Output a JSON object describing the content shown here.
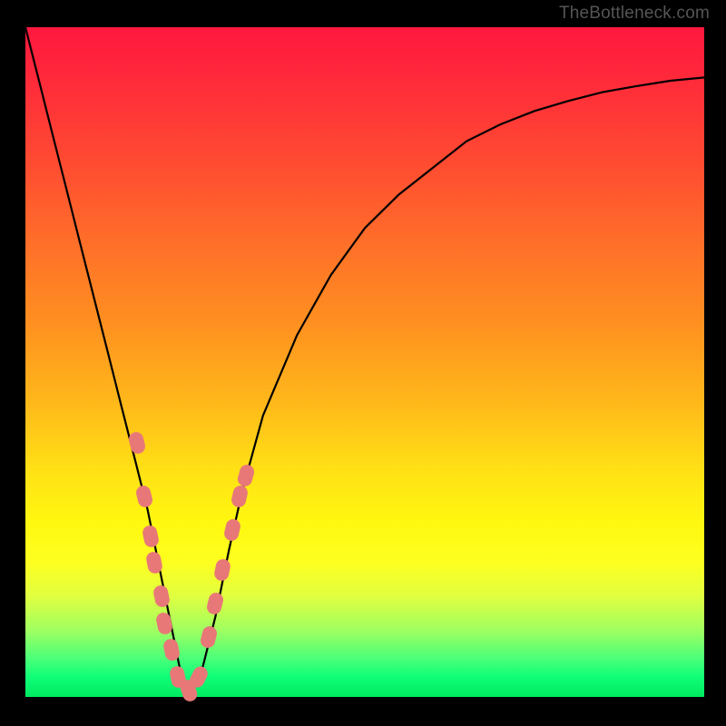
{
  "watermark": "TheBottleneck.com",
  "chart_data": {
    "type": "line",
    "title": "",
    "xlabel": "",
    "ylabel": "",
    "xlim": [
      0,
      100
    ],
    "ylim": [
      0,
      100
    ],
    "series": [
      {
        "name": "curve",
        "x": [
          0,
          2,
          4,
          6,
          8,
          10,
          12,
          14,
          16,
          18,
          20,
          22,
          23,
          24,
          26,
          28,
          30,
          32,
          35,
          40,
          45,
          50,
          55,
          60,
          65,
          70,
          75,
          80,
          85,
          90,
          95,
          100
        ],
        "y": [
          100,
          92,
          84,
          76,
          68,
          60,
          52,
          44,
          36,
          28,
          18,
          8,
          3,
          0,
          4,
          12,
          22,
          31,
          42,
          54,
          63,
          70,
          75,
          79,
          83,
          85.5,
          87.5,
          89,
          90.3,
          91.2,
          92,
          92.5
        ]
      }
    ],
    "markers": [
      {
        "x": 16.5,
        "y": 38
      },
      {
        "x": 17.5,
        "y": 30
      },
      {
        "x": 18.5,
        "y": 24
      },
      {
        "x": 19.0,
        "y": 20
      },
      {
        "x": 20.0,
        "y": 15
      },
      {
        "x": 20.5,
        "y": 11
      },
      {
        "x": 21.5,
        "y": 7
      },
      {
        "x": 22.5,
        "y": 3
      },
      {
        "x": 24.0,
        "y": 1
      },
      {
        "x": 25.5,
        "y": 3
      },
      {
        "x": 27.0,
        "y": 9
      },
      {
        "x": 28.0,
        "y": 14
      },
      {
        "x": 29.0,
        "y": 19
      },
      {
        "x": 30.5,
        "y": 25
      },
      {
        "x": 31.5,
        "y": 30
      },
      {
        "x": 32.5,
        "y": 33
      }
    ]
  }
}
